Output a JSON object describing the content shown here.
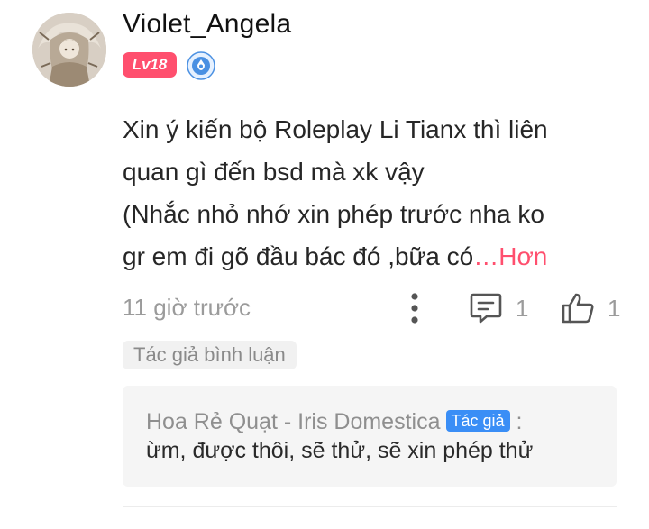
{
  "comment": {
    "user": {
      "name": "Violet_Angela",
      "level": "Lv18"
    },
    "text_lines": [
      "Xin ý kiến bộ Roleplay Li Tianx thì liên",
      "quan gì đến bsd mà xk vậy",
      "(Nhắc nhỏ nhớ xin phép trước nha ko",
      "gr em đi gõ đầu bác đó ,bữa có"
    ],
    "more_label": "…Hơn",
    "timestamp": "11 giờ trước",
    "reply_count": "1",
    "like_count": "1",
    "author_tag": "Tác giả bình luận"
  },
  "reply": {
    "author": "Hoa Rẻ Quạt - Iris Domestica",
    "author_badge": "Tác giả",
    "separator": " :",
    "text": "ừm, được thôi, sẽ thử, sẽ xin phép thử"
  },
  "colors": {
    "accent": "#ff4f6e",
    "badge_blue": "#3a8ef6",
    "muted_text": "#9b9b9b"
  },
  "icons": {
    "verify": "verified-badge-icon",
    "more": "more-vertical-icon",
    "reply": "comment-icon",
    "like": "thumbs-up-icon"
  }
}
